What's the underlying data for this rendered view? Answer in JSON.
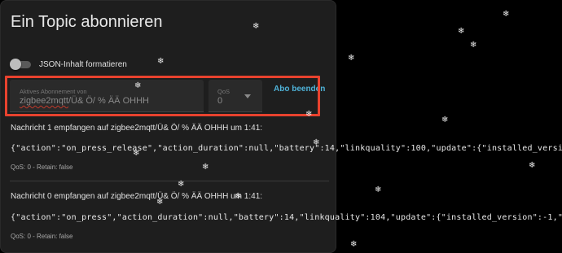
{
  "dialog": {
    "title": "Ein Topic abonnieren",
    "json_toggle_label": "JSON-Inhalt formatieren",
    "subscription_label": "Aktives Abonnement von",
    "subscription_value_underlined": "zigbee2mqtt",
    "subscription_value_rest": "/Ü& Ö/ % ÄÄ OHHH",
    "qos_label": "QoS",
    "qos_value": "0",
    "unsubscribe_label": "Abo beenden"
  },
  "messages": [
    {
      "header": "Nachricht 1 empfangen auf zigbee2mqtt/Ü& Ö/ % ÄÄ OHHH um 1:41:",
      "payload": "{\"action\":\"on_press_release\",\"action_duration\":null,\"battery\":14,\"linkquality\":100,\"update\":{\"installed_version\":-1,\"",
      "meta": "QoS: 0 - Retain: false"
    },
    {
      "header": "Nachricht 0 empfangen auf zigbee2mqtt/Ü& Ö/ % ÄÄ OHHH um 1:41:",
      "payload": "{\"action\":\"on_press\",\"action_duration\":null,\"battery\":14,\"linkquality\":104,\"update\":{\"installed_version\":-1,\"latest_v",
      "meta": "QoS: 0 - Retain: false"
    }
  ],
  "colors": {
    "highlight": "#e8422e",
    "accent_link": "#4fb3d9",
    "card_bg": "#1e1e1e",
    "page_bg": "#000000"
  },
  "decorations": {
    "snowflake_glyph": "❄"
  }
}
